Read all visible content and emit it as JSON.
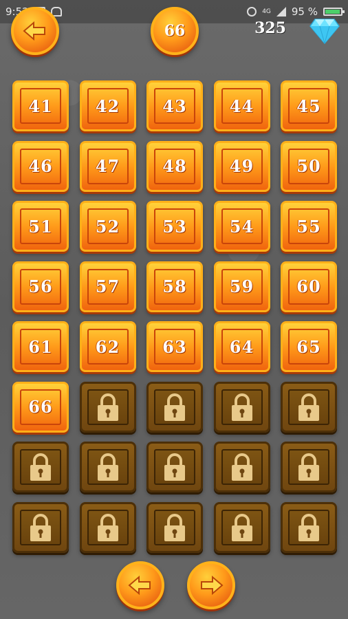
{
  "status_bar": {
    "time": "9:52",
    "network": "4G",
    "battery": "95 %"
  },
  "header": {
    "back_icon": "arrow-left-icon",
    "current_level": "66",
    "gems": "325",
    "gem_icon": "diamond-icon"
  },
  "levels": [
    {
      "label": "41",
      "locked": false
    },
    {
      "label": "42",
      "locked": false
    },
    {
      "label": "43",
      "locked": false
    },
    {
      "label": "44",
      "locked": false
    },
    {
      "label": "45",
      "locked": false
    },
    {
      "label": "46",
      "locked": false
    },
    {
      "label": "47",
      "locked": false
    },
    {
      "label": "48",
      "locked": false
    },
    {
      "label": "49",
      "locked": false
    },
    {
      "label": "50",
      "locked": false
    },
    {
      "label": "51",
      "locked": false
    },
    {
      "label": "52",
      "locked": false
    },
    {
      "label": "53",
      "locked": false
    },
    {
      "label": "54",
      "locked": false
    },
    {
      "label": "55",
      "locked": false
    },
    {
      "label": "56",
      "locked": false
    },
    {
      "label": "57",
      "locked": false
    },
    {
      "label": "58",
      "locked": false
    },
    {
      "label": "59",
      "locked": false
    },
    {
      "label": "60",
      "locked": false
    },
    {
      "label": "61",
      "locked": false
    },
    {
      "label": "62",
      "locked": false
    },
    {
      "label": "63",
      "locked": false
    },
    {
      "label": "64",
      "locked": false
    },
    {
      "label": "65",
      "locked": false
    },
    {
      "label": "66",
      "locked": false
    },
    {
      "label": "",
      "locked": true
    },
    {
      "label": "",
      "locked": true
    },
    {
      "label": "",
      "locked": true
    },
    {
      "label": "",
      "locked": true
    },
    {
      "label": "",
      "locked": true
    },
    {
      "label": "",
      "locked": true
    },
    {
      "label": "",
      "locked": true
    },
    {
      "label": "",
      "locked": true
    },
    {
      "label": "",
      "locked": true
    },
    {
      "label": "",
      "locked": true
    },
    {
      "label": "",
      "locked": true
    },
    {
      "label": "",
      "locked": true
    },
    {
      "label": "",
      "locked": true
    },
    {
      "label": "",
      "locked": true
    }
  ],
  "footer": {
    "prev_icon": "arrow-left-icon",
    "next_icon": "arrow-right-icon"
  },
  "colors": {
    "tile_unlocked": "#ff9b1a",
    "tile_locked": "#6f4610",
    "background": "#5f5f5f"
  }
}
